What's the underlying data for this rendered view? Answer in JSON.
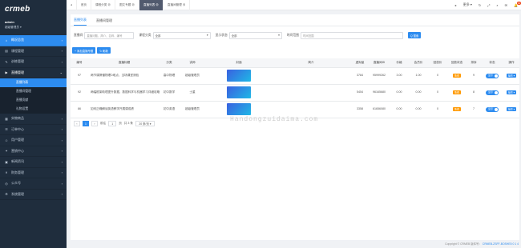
{
  "brand": {
    "logo": "crmeb"
  },
  "user": {
    "name": "admin",
    "role": "超级管理员 ▾"
  },
  "sidebar": {
    "items": [
      {
        "icon": "home-icon",
        "glyph": "⌂",
        "label": "概况总览",
        "active": true
      },
      {
        "icon": "course-icon",
        "glyph": "▤",
        "label": "课程管理"
      },
      {
        "icon": "exam-icon",
        "glyph": "✎",
        "label": "训练管理"
      },
      {
        "icon": "live-icon",
        "glyph": "▶",
        "label": "直播管理",
        "open": true
      }
    ],
    "subitems": [
      {
        "label": "直播列表",
        "active": true
      },
      {
        "label": "直播间管理"
      },
      {
        "label": "直播贡献"
      },
      {
        "label": "礼物设置"
      }
    ],
    "bottom": [
      {
        "icon": "goods-icon",
        "glyph": "▦",
        "label": "实物商品"
      },
      {
        "icon": "order-icon",
        "glyph": "☰",
        "label": "订单中心"
      },
      {
        "icon": "user-icon",
        "glyph": "☺",
        "label": "用户管理"
      },
      {
        "icon": "marketing-icon",
        "glyph": "✦",
        "label": "营销中心"
      },
      {
        "icon": "news-icon",
        "glyph": "▣",
        "label": "新闻资讯"
      },
      {
        "icon": "finance-icon",
        "glyph": "¥",
        "label": "财务管理"
      },
      {
        "icon": "account-icon",
        "glyph": "◎",
        "label": "公众号"
      },
      {
        "icon": "system-icon",
        "glyph": "⚙",
        "label": "系统管理"
      }
    ]
  },
  "topbar": {
    "tabs": [
      {
        "label": "首页"
      },
      {
        "label": "课程分类 ⊗"
      },
      {
        "label": "图文专题 ⊗"
      },
      {
        "label": "直播列表 ⊗",
        "active": true
      },
      {
        "label": "直播间管理 ⊗"
      }
    ],
    "more_label": "更多 ▾",
    "notification_count": "19"
  },
  "subtabs": [
    {
      "label": "直播列表",
      "active": true
    },
    {
      "label": "直播间管理"
    }
  ],
  "filters": {
    "room_label": "直播间",
    "room_placeholder": "直播问题、简介、名称、编号",
    "category_label": "课程分类",
    "category_value": "全部",
    "status_label": "显示状态",
    "status_value": "全部",
    "time_label": "时间范围",
    "time_placeholder": "时间范围",
    "search_label": "Q 搜索"
  },
  "actions": {
    "add_label": "+ 添加直播专题",
    "refresh_label": "↻ 刷新"
  },
  "table": {
    "headers": [
      "编号",
      "直播标题",
      "分类",
      "讲师",
      "封面",
      "简介",
      "虚拟量",
      "直播间ID",
      "价格",
      "会员价",
      "回放价",
      "回放状态",
      "排序",
      "状态",
      "操作"
    ],
    "rows": [
      {
        "id": "97",
        "title": "两节课搞懂物理D难点，当场课堂测验",
        "category": "高中物理",
        "teacher": "超级管理员",
        "intro": "",
        "virtual": "3784",
        "room": "95999262",
        "price": "3.00",
        "member": "1.00",
        "replay_price": "0",
        "replay_status": "免费",
        "sort": "9",
        "status": "显示",
        "op": "操作 ▾"
      },
      {
        "id": "92",
        "title": "两幅框架助理提升数据，数据科学与机器学习详细攻略",
        "category": "初中数学",
        "teacher": "士重",
        "intro": "",
        "virtual": "5454",
        "room": "96165680",
        "price": "0.00",
        "member": "0.00",
        "replay_price": "0",
        "replay_status": "免费",
        "sort": "8",
        "status": "显示",
        "op": "操作 ▾"
      },
      {
        "id": "86",
        "title": "如何正确解读英语教学开展课成绩",
        "category": "初中英语",
        "teacher": "超级管理员",
        "intro": "",
        "virtual": "3358",
        "room": "61656080",
        "price": "0.00",
        "member": "0.00",
        "replay_price": "0",
        "replay_status": "免费",
        "sort": "7",
        "status": "显示",
        "op": "操作 ▾"
      }
    ]
  },
  "pager": {
    "prev": "‹",
    "page": "1",
    "next": "›",
    "goto_label": "前往",
    "goto_value": "1",
    "page_unit": "页",
    "total": "共 3 条",
    "size": "20 条/页 ▾"
  },
  "watermark": "Handongzuidaima.com",
  "footer": {
    "copyright": "Copyright © CRMEB 版本号：",
    "version": "CRMEB-ZSFF-BOSHE5 0 1 4"
  }
}
